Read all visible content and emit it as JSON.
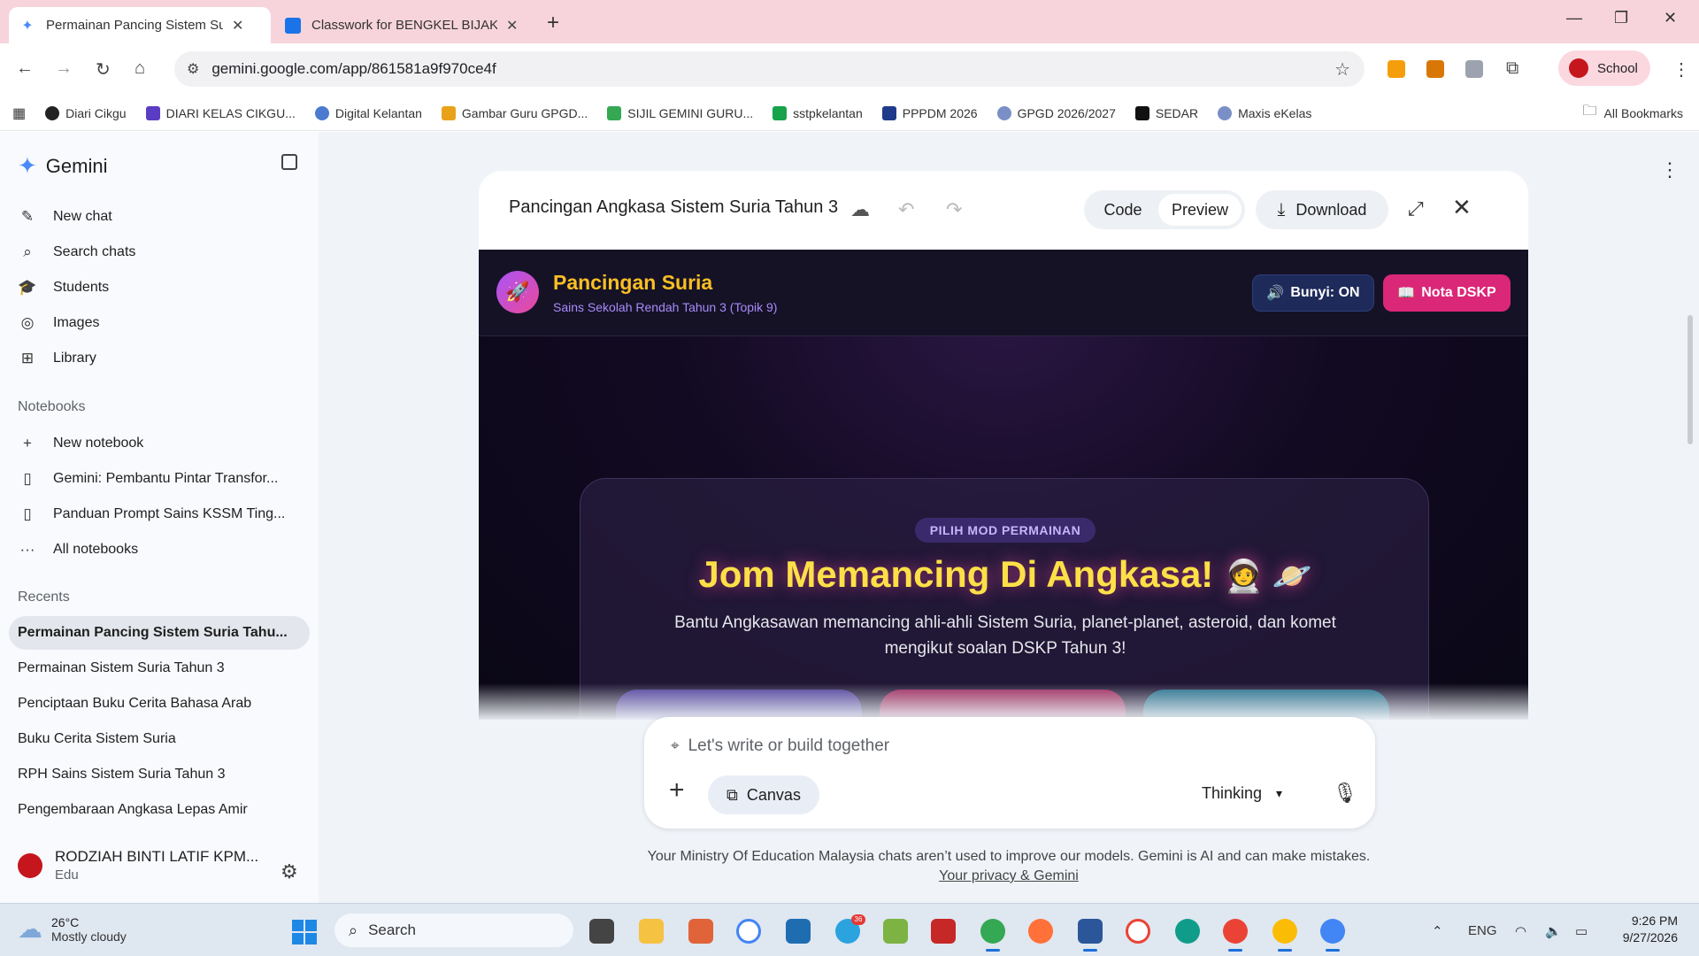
{
  "browser": {
    "tabs": [
      {
        "title": "Permainan Pancing Sistem Suria",
        "active": true
      },
      {
        "title": "Classwork for BENGKEL BIJAK D",
        "active": false
      }
    ],
    "url": "gemini.google.com/app/861581a9f970ce4f",
    "profile_label": "School",
    "bookmarks": [
      "Diari Cikgu",
      "DIARI KELAS CIKGU...",
      "Digital Kelantan",
      "Gambar Guru GPGD...",
      "SIJIL GEMINI GURU...",
      "sstpkelantan",
      "PPPDM 2026",
      "GPGD 2026/2027",
      "SEDAR",
      "Maxis eKelas"
    ],
    "all_bookmarks": "All Bookmarks"
  },
  "sidebar": {
    "app_name": "Gemini",
    "nav": [
      "New chat",
      "Search chats",
      "Students",
      "Images",
      "Library"
    ],
    "notebooks_heading": "Notebooks",
    "notebooks": [
      "New notebook",
      "Gemini: Pembantu Pintar Transfor...",
      "Panduan Prompt Sains KSSM Ting...",
      "All notebooks"
    ],
    "recents_heading": "Recents",
    "recents": [
      "Permainan Pancing Sistem Suria Tahu...",
      "Permainan Sistem Suria Tahun 3",
      "Penciptaan Buku Cerita Bahasa Arab",
      "Buku Cerita Sistem Suria",
      "RPH Sains Sistem Suria Tahun 3",
      "Pengembaraan Angkasa Lepas Amir"
    ],
    "user_name": "RODZIAH BINTI LATIF KPM...",
    "user_org": "Edu"
  },
  "canvas": {
    "title": "Pancingan Angkasa Sistem Suria Tahun 3",
    "code_label": "Code",
    "preview_label": "Preview",
    "download_label": "Download"
  },
  "game": {
    "title": "Pancingan Suria",
    "subtitle": "Sains Sekolah Rendah Tahun 3 (Topik 9)",
    "sound_label": "Bunyi: ON",
    "notes_label": "Nota DSKP",
    "mode_pill": "PILIH MOD PERMAINAN",
    "headline": "Jom Memancing Di Angkasa!",
    "headline_emoji": "🧑‍🚀 🪐",
    "description": "Bantu Angkasawan memancing ahli-ahli Sistem Suria, planet-planet, asteroid, dan komet mengikut soalan DSKP Tahun 3!"
  },
  "prompt": {
    "placeholder": "Let's write or build together",
    "canvas_chip": "Canvas",
    "mode": "Thinking"
  },
  "footer": {
    "disclaimer": "Your Ministry Of Education Malaysia chats aren’t used to improve our models. Gemini is AI and can make mistakes.",
    "privacy_link": "Your privacy & Gemini"
  },
  "taskbar": {
    "temperature": "26°C",
    "condition": "Mostly cloudy",
    "search_label": "Search",
    "telegram_badge": "36",
    "language": "ENG",
    "time": "9:26 PM",
    "date": "9/27/2026"
  },
  "colors": {
    "accent_pink": "#db2777",
    "game_gold": "#fbbf24",
    "chrome_pink": "#f7d4dc"
  }
}
